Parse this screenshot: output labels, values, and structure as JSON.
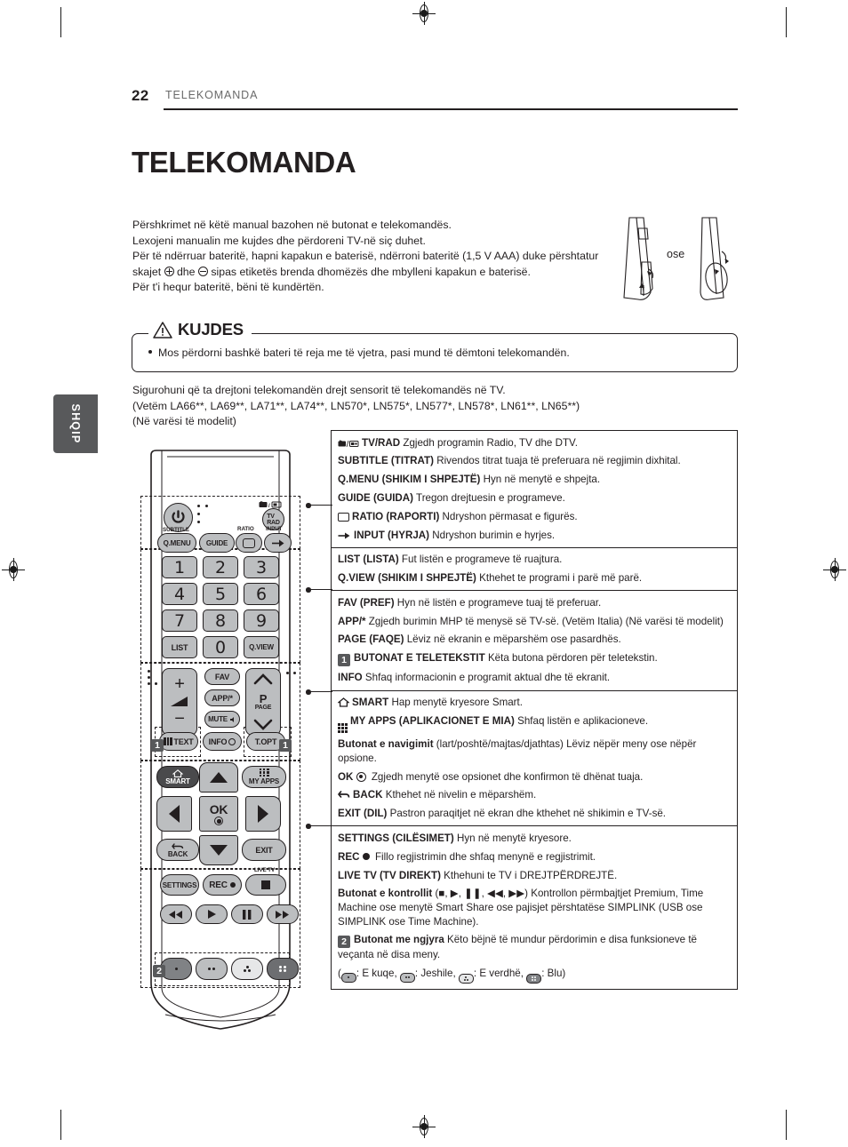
{
  "header": {
    "page_number": "22",
    "section": "TELEKOMANDA"
  },
  "page_title": "TELEKOMANDA",
  "intro": {
    "line1": "Përshkrimet në këtë manual bazohen në butonat e telekomandës.",
    "line2": "Lexojeni manualin me kujdes dhe përdoreni TV-në siç duhet.",
    "line3a": "Për të ndërruar bateritë, hapni kapakun e baterisë, ndërroni bateritë (1,5 V AAA) duke përshtatur skajet",
    "line3b": "dhe",
    "line3c": "sipas etiketës brenda dhomëzës dhe mbylleni kapakun e baterisë.",
    "line4": "Për t'i hequr bateritë, bëni të kundërtën."
  },
  "battery_diagram": {
    "or_label": "ose"
  },
  "caution": {
    "title": "KUJDES",
    "bullet": "Mos përdorni bashkë bateri të reja me të vjetra, pasi mund të dëmtoni telekomandën."
  },
  "note": {
    "line1": "Sigurohuni që ta drejtoni telekomandën drejt sensorit të telekomandës në TV.",
    "line2": "(Vetëm LA66**, LA69**, LA71**, LA74**, LN570*, LN575*, LN577*, LN578*, LN61**, LN65**)",
    "line3": "(Në varësi të modelit)"
  },
  "language_tab": "SHQIP",
  "remote": {
    "buttons": {
      "power": "power-icon",
      "tvrad": "TV/RAD",
      "subtitle_label": "SUBTITLE",
      "qmenu": "Q.MENU",
      "guide": "GUIDE",
      "ratio_label": "RATIO",
      "input_label": "INPUT",
      "n1": "1",
      "n2": "2",
      "n3": "3",
      "n4": "4",
      "n5": "5",
      "n6": "6",
      "n7": "7",
      "n8": "8",
      "n9": "9",
      "n0": "0",
      "list": "LIST",
      "qview": "Q.VIEW",
      "vol_plus": "+",
      "vol_minus": "−",
      "fav": "FAV",
      "app": "APP/*",
      "mute": "MUTE",
      "page_p": "P",
      "page_label": "PAGE",
      "text": "TEXT",
      "info": "INFO",
      "topt": "T.OPT",
      "smart": "SMART",
      "myapps": "MY APPS",
      "ok": "OK",
      "back": "BACK",
      "exit": "EXIT",
      "live_tv_label": "LIVE TV",
      "settings": "SETTINGS",
      "rec": "REC",
      "badge1": "1",
      "badge2": "2"
    }
  },
  "table": {
    "groups": [
      {
        "rows": [
          {
            "icon": "tv-radio-icon",
            "bold": "TV/RAD",
            "text": " Zgjedh programin Radio, TV dhe DTV."
          },
          {
            "bold": "SUBTITLE (TITRAT)",
            "text": " Rivendos titrat tuaja të preferuara në regjimin dixhital."
          },
          {
            "bold": "Q.MENU (SHIKIM I SHPEJTË)",
            "text": " Hyn në menytë e shpejta."
          },
          {
            "bold": "GUIDE (GUIDA)",
            "text": " Tregon drejtuesin e programeve."
          },
          {
            "icon": "ratio-icon",
            "bold": "RATIO (RAPORTI)",
            "text": " Ndryshon përmasat e figurës."
          },
          {
            "icon": "input-icon",
            "bold": "INPUT (HYRJA)",
            "text": " Ndryshon burimin e hyrjes."
          }
        ]
      },
      {
        "rows": [
          {
            "bold": "LIST (LISTA)",
            "text": " Fut listën e programeve të ruajtura."
          },
          {
            "bold": "Q.VIEW (SHIKIM I SHPEJTË)",
            "text": " Kthehet te programi i parë më parë."
          }
        ]
      },
      {
        "rows": [
          {
            "bold": "FAV (PREF)",
            "text": " Hyn në listën e programeve tuaj të preferuar."
          },
          {
            "bold": "APP/*",
            "text": " Zgjedh burimin MHP të menysë së TV-së. (Vetëm Italia) (Në varësi të modelit)"
          },
          {
            "bold": "PAGE (FAQE)",
            "text": " Lëviz në ekranin e mëparshëm ose pasardhës."
          },
          {
            "badge": "1",
            "bold": "BUTONAT E TELETEKSTIT",
            "text": " Këta butona përdoren për teletekstin."
          },
          {
            "bold": "INFO",
            "text": " Shfaq informacionin e programit aktual dhe të ekranit."
          }
        ]
      },
      {
        "rows": [
          {
            "icon": "home-icon",
            "bold": "SMART",
            "text": " Hap menytë kryesore Smart."
          },
          {
            "icon": "apps-grid-icon",
            "bold": "MY APPS (APLIKACIONET E MIA)",
            "text": " Shfaq listën e aplikacioneve."
          },
          {
            "bold": "Butonat e navigimit",
            "text": " (lart/poshtë/majtas/djathtas) Lëviz nëpër meny ose nëpër opsione."
          },
          {
            "bold": "OK",
            "icon_after": "ok-icon",
            "text": " Zgjedh menytë ose opsionet dhe konfirmon të dhënat tuaja."
          },
          {
            "icon": "back-arrow-icon",
            "bold": "BACK",
            "text": " Kthehet në nivelin e mëparshëm."
          },
          {
            "bold": "EXIT (DIL)",
            "text": "  Pastron paraqitjet në ekran dhe kthehet në shikimin e TV-së."
          }
        ]
      },
      {
        "rows": [
          {
            "bold": "SETTINGS (CILËSIMET)",
            "text": " Hyn në menytë kryesore."
          },
          {
            "bold": "REC",
            "icon_after": "record-dot-icon",
            "text": " Fillo regjistrimin dhe shfaq menynë e regjistrimit."
          },
          {
            "bold": "LIVE TV (TV DIREKT)",
            "text": " Kthehuni te TV i DREJTPËRDREJTË."
          },
          {
            "bold": "Butonat e kontrollit",
            "text": " (■, ▶, ❚❚, ◀◀, ▶▶) Kontrollon përmbajtjet Premium, Time Machine ose menytë Smart Share ose pajisjet përshtatëse SIMPLINK (USB ose SIMPLINK ose Time Machine)."
          },
          {
            "badge": "2",
            "bold": "Butonat me ngjyra",
            "text": " Këto bëjnë të mundur përdorimin e disa funksioneve të veçanta në disa meny."
          },
          {
            "color_legend": [
              "E kuqe",
              "Jeshile",
              "E verdhë",
              "Blu"
            ]
          }
        ]
      }
    ]
  }
}
